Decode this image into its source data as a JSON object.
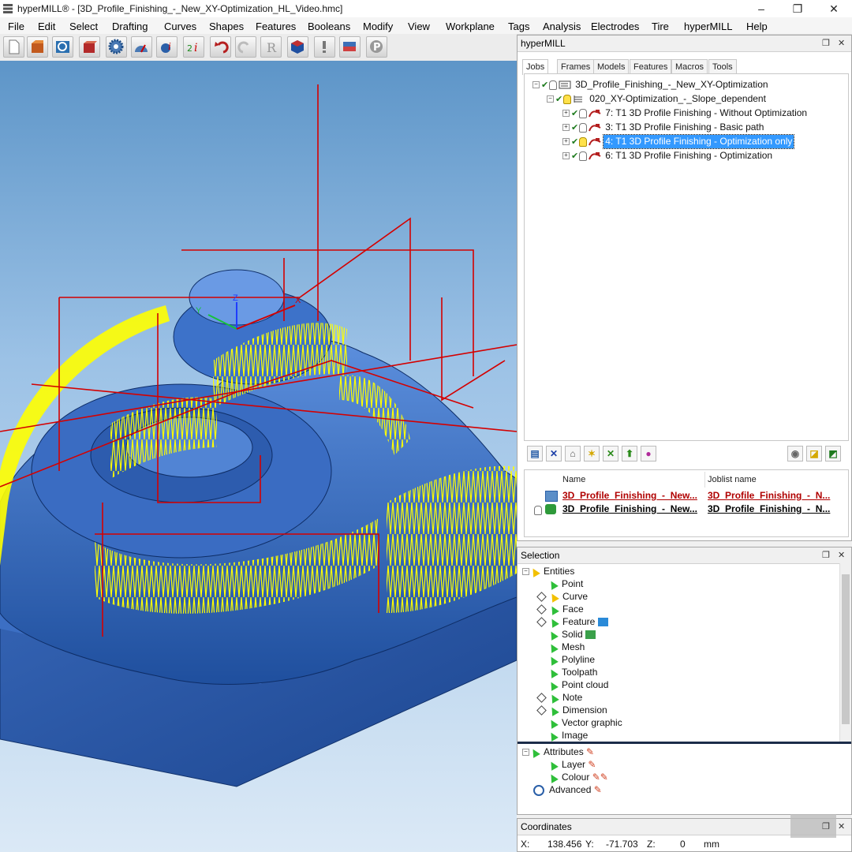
{
  "window": {
    "title": "hyperMILL® - [3D_Profile_Finishing_-_New_XY-Optimization_HL_Video.hmc]",
    "min_glyph": "–",
    "max_glyph": "❐",
    "close_glyph": "✕"
  },
  "menu": [
    "File",
    "Edit",
    "Select",
    "Drafting",
    "Curves",
    "Shapes",
    "Features",
    "Booleans",
    "Modify",
    "View",
    "Workplane",
    "Tags",
    "Analysis",
    "Electrodes",
    "Tire",
    "hyperMILL",
    "Help"
  ],
  "viewport": {
    "axis_x": "X",
    "axis_y": "Y",
    "axis_z": "Z",
    "colors": {
      "part": "#2f63b8",
      "toolpath": "#ffff00",
      "links": "#d40000"
    }
  },
  "hypermill_panel": {
    "title": "hyperMILL",
    "tabs": [
      "Jobs",
      "Frames",
      "Models",
      "Features",
      "Macros",
      "Tools"
    ],
    "active_tab": "Jobs",
    "tree": {
      "root": "3D_Profile_Finishing_-_New_XY-Optimization",
      "joblist": "020_XY-Optimization_-_Slope_dependent",
      "jobs": [
        "7: T1 3D Profile Finishing - Without Optimization",
        "3: T1 3D Profile Finishing - Basic path",
        "4: T1 3D Profile Finishing - Optimization only",
        "6: T1 3D Profile Finishing - Optimization"
      ],
      "selected_index": 2
    },
    "list": {
      "col_name": "Name",
      "col_joblist": "Joblist name",
      "rows": [
        {
          "name": "3D_Profile_Finishing_-_New...",
          "joblist": "3D_Profile_Finishing_-_N..."
        },
        {
          "name": "3D_Profile_Finishing_-_New...",
          "joblist": "3D_Profile_Finishing_-_N..."
        }
      ]
    }
  },
  "selection_panel": {
    "title": "Selection",
    "entities_label": "Entities",
    "entities": [
      "Point",
      "Curve",
      "Face",
      "Feature",
      "Solid",
      "Mesh",
      "Polyline",
      "Toolpath",
      "Point cloud",
      "Note",
      "Dimension",
      "Vector graphic",
      "Image"
    ],
    "attributes_label": "Attributes",
    "attributes": [
      "Layer",
      "Colour"
    ],
    "advanced_label": "Advanced"
  },
  "coordinates_panel": {
    "title": "Coordinates",
    "x_label": "X:",
    "x_value": "138.456",
    "y_label": "Y:",
    "y_value": "-71.703",
    "z_label": "Z:",
    "z_value": "0",
    "unit": "mm"
  }
}
